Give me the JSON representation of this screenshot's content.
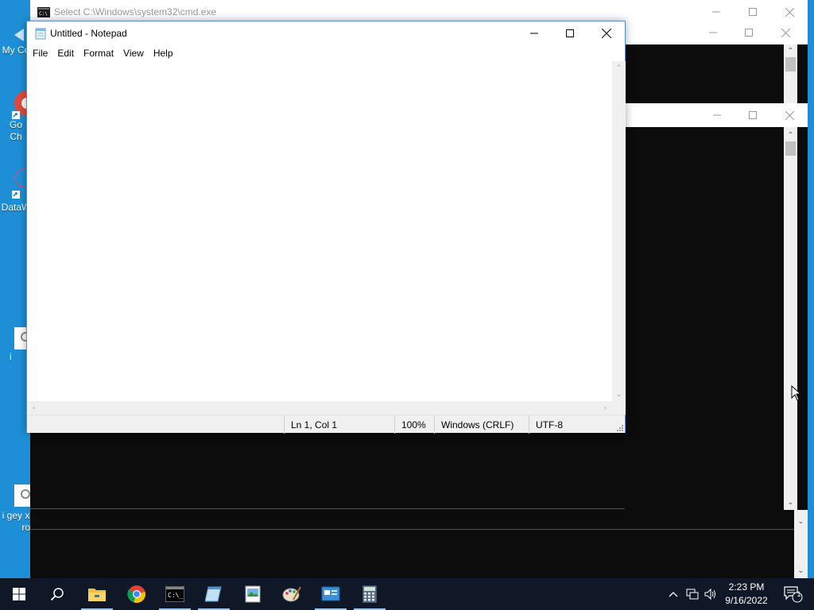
{
  "desktop": {
    "icons": [
      {
        "name": "my-computer",
        "label": "My Co"
      },
      {
        "name": "google-chrome",
        "label": "Go",
        "label2": "Ch"
      },
      {
        "name": "datawrapper",
        "label": "DataW"
      },
      {
        "name": "file-i",
        "label": "i"
      },
      {
        "name": "file-i-gey",
        "label": "i gey x",
        "label2": "ro"
      }
    ]
  },
  "cmd_windows": {
    "front_title": "Select C:\\Windows\\system32\\cmd.exe"
  },
  "notepad": {
    "title": "Untitled - Notepad",
    "menu": [
      "File",
      "Edit",
      "Format",
      "View",
      "Help"
    ],
    "content": "",
    "status": {
      "position": "Ln 1, Col 1",
      "zoom": "100%",
      "line_ending": "Windows (CRLF)",
      "encoding": "UTF-8"
    }
  },
  "taskbar": {
    "apps": [
      "start",
      "search",
      "file-explorer",
      "chrome",
      "cmd",
      "notepad",
      "image-viewer",
      "paint",
      "control-panel",
      "calculator"
    ],
    "clock": {
      "time": "2:23 PM",
      "date": "9/16/2022"
    },
    "notification_count": "1"
  },
  "colors": {
    "desktop": "#1e8fd6",
    "taskbar": "#101828",
    "console": "#0c0c0c"
  }
}
